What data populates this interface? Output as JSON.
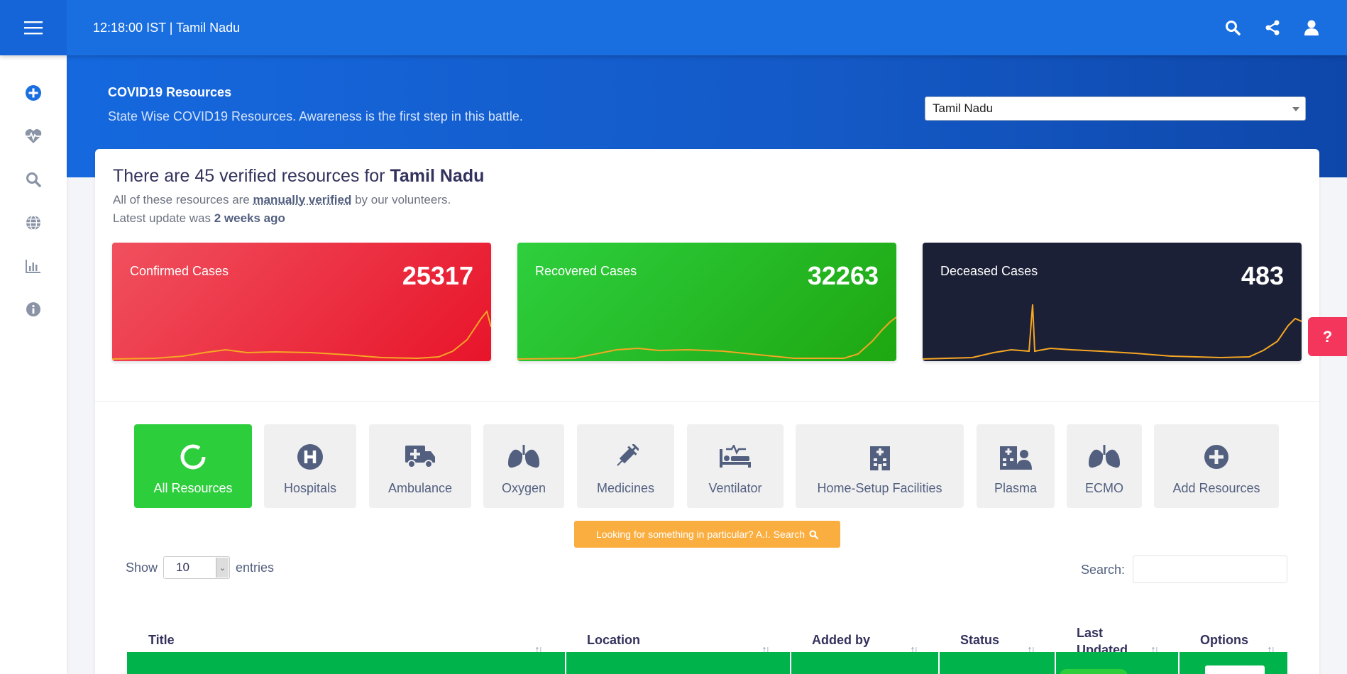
{
  "topbar": {
    "clock": "12:18:00 IST | Tamil Nadu"
  },
  "hero": {
    "title": "COVID19 Resources",
    "subtitle": "State Wise COVID19 Resources. Awareness is the first step in this battle.",
    "state_selected": "Tamil Nadu"
  },
  "summary": {
    "prefix": "There are 45 verified resources for ",
    "state": "Tamil Nadu",
    "line1_a": "All of these resources are ",
    "line1_link": "manually verified",
    "line1_b": " by our volunteers.",
    "line2_a": "Latest update was ",
    "line2_b": "2 weeks ago"
  },
  "stats": [
    {
      "label": "Confirmed Cases",
      "value": "25317",
      "color_start": "#f0505e",
      "color_end": "#e8142a"
    },
    {
      "label": "Recovered Cases",
      "value": "32263",
      "color_start": "#2ecf3e",
      "color_end": "#1ea711"
    },
    {
      "label": "Deceased Cases",
      "value": "483",
      "color_start": "#1b2036",
      "color_end": "#1b2036"
    }
  ],
  "tabs": [
    {
      "label": "All Resources",
      "icon": "loading-ring-icon",
      "active": true
    },
    {
      "label": "Hospitals",
      "icon": "hospital-h-icon"
    },
    {
      "label": "Ambulance",
      "icon": "ambulance-icon"
    },
    {
      "label": "Oxygen",
      "icon": "lungs-icon"
    },
    {
      "label": "Medicines",
      "icon": "syringe-icon"
    },
    {
      "label": "Ventilator",
      "icon": "bed-pulse-icon"
    },
    {
      "label": "Home-Setup Facilities",
      "icon": "hospital-building-icon"
    },
    {
      "label": "Plasma",
      "icon": "hospital-user-icon"
    },
    {
      "label": "ECMO",
      "icon": "lungs-icon"
    },
    {
      "label": "Add Resources",
      "icon": "plus-circle-icon"
    }
  ],
  "ai_search": "Looking for something in particular? A.I. Search",
  "table": {
    "show_label": "Show",
    "entries_value": "10",
    "entries_label": "entries",
    "search_label": "Search:",
    "columns": [
      "Title",
      "Location",
      "Added by",
      "Status",
      "Last Updated",
      "Options"
    ]
  },
  "help_label": "?"
}
